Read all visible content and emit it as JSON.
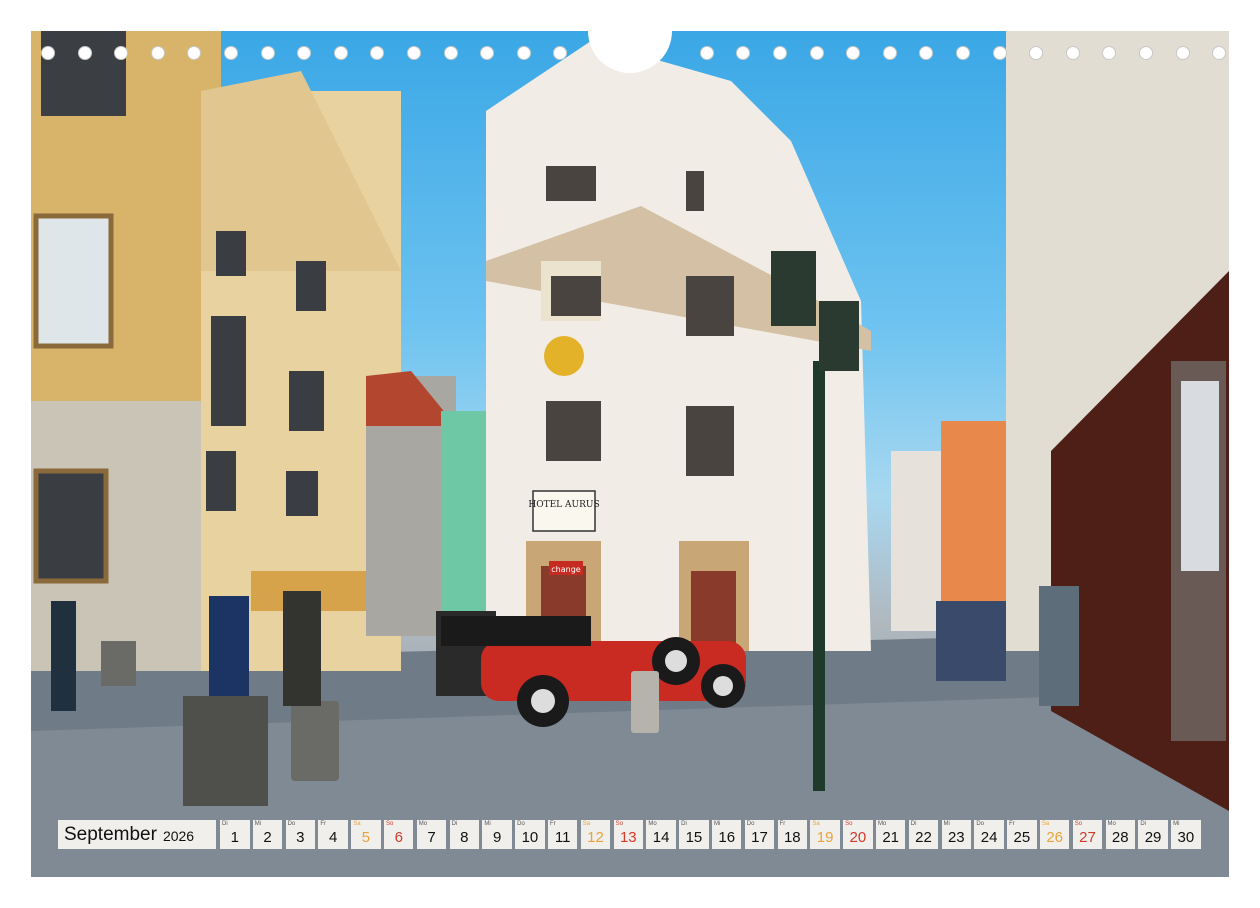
{
  "calendar": {
    "month": "September",
    "year": "2026",
    "days": [
      {
        "wd": "Di",
        "d": "1",
        "t": "w"
      },
      {
        "wd": "Mi",
        "d": "2",
        "t": "w"
      },
      {
        "wd": "Do",
        "d": "3",
        "t": "w"
      },
      {
        "wd": "Fr",
        "d": "4",
        "t": "w"
      },
      {
        "wd": "Sa",
        "d": "5",
        "t": "sat"
      },
      {
        "wd": "So",
        "d": "6",
        "t": "sun"
      },
      {
        "wd": "Mo",
        "d": "7",
        "t": "w"
      },
      {
        "wd": "Di",
        "d": "8",
        "t": "w"
      },
      {
        "wd": "Mi",
        "d": "9",
        "t": "w"
      },
      {
        "wd": "Do",
        "d": "10",
        "t": "w"
      },
      {
        "wd": "Fr",
        "d": "11",
        "t": "w"
      },
      {
        "wd": "Sa",
        "d": "12",
        "t": "sat"
      },
      {
        "wd": "So",
        "d": "13",
        "t": "sun"
      },
      {
        "wd": "Mo",
        "d": "14",
        "t": "w"
      },
      {
        "wd": "Di",
        "d": "15",
        "t": "w"
      },
      {
        "wd": "Mi",
        "d": "16",
        "t": "w"
      },
      {
        "wd": "Do",
        "d": "17",
        "t": "w"
      },
      {
        "wd": "Fr",
        "d": "18",
        "t": "w"
      },
      {
        "wd": "Sa",
        "d": "19",
        "t": "sat"
      },
      {
        "wd": "So",
        "d": "20",
        "t": "sun"
      },
      {
        "wd": "Mo",
        "d": "21",
        "t": "w"
      },
      {
        "wd": "Di",
        "d": "22",
        "t": "w"
      },
      {
        "wd": "Mi",
        "d": "23",
        "t": "w"
      },
      {
        "wd": "Do",
        "d": "24",
        "t": "w"
      },
      {
        "wd": "Fr",
        "d": "25",
        "t": "w"
      },
      {
        "wd": "Sa",
        "d": "26",
        "t": "sat"
      },
      {
        "wd": "So",
        "d": "27",
        "t": "sun"
      },
      {
        "wd": "Mo",
        "d": "28",
        "t": "w"
      },
      {
        "wd": "Di",
        "d": "29",
        "t": "w"
      },
      {
        "wd": "Mi",
        "d": "30",
        "t": "w"
      }
    ]
  },
  "photo": {
    "signs": {
      "hotel": "HOTEL AURUS",
      "exchange": "change"
    }
  },
  "colors": {
    "weekday_text": "#111111",
    "saturday_text": "#e8a23a",
    "sunday_text": "#d23a2a",
    "cell_bg": "#f0efec"
  }
}
